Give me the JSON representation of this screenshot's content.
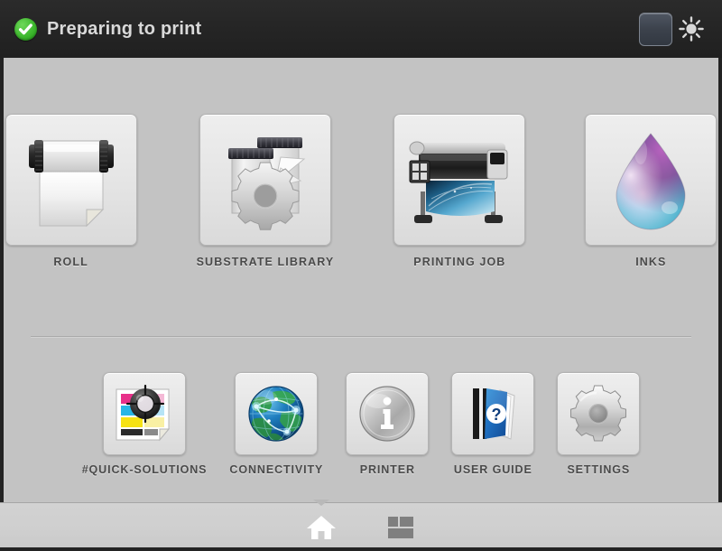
{
  "header": {
    "title": "Preparing to print",
    "status_icon": "check-circle-icon",
    "status_color": "#3eb82e",
    "controls": [
      {
        "name": "screen-dim-button",
        "icon": "screen-icon"
      },
      {
        "name": "brightness-button",
        "icon": "sun-icon"
      }
    ]
  },
  "main": {
    "primary_tiles": [
      {
        "label": "ROLL",
        "icon": "paper-roll-icon"
      },
      {
        "label": "SUBSTRATE LIBRARY",
        "icon": "substrate-gear-icon"
      },
      {
        "label": "PRINTING JOB",
        "icon": "large-format-printer-icon"
      },
      {
        "label": "INKS",
        "icon": "ink-droplet-icon"
      }
    ],
    "secondary_tiles": [
      {
        "label": "#QUICK-SOLUTIONS",
        "icon": "color-calibration-icon"
      },
      {
        "label": "CONNECTIVITY",
        "icon": "globe-network-icon"
      },
      {
        "label": "PRINTER",
        "icon": "info-disc-icon"
      },
      {
        "label": "USER GUIDE",
        "icon": "help-book-icon"
      },
      {
        "label": "SETTINGS",
        "icon": "gear-icon"
      }
    ]
  },
  "navigation": {
    "items": [
      {
        "name": "home",
        "icon": "home-icon",
        "active": true
      },
      {
        "name": "tiles",
        "icon": "grid-icon",
        "active": false
      }
    ]
  },
  "colors": {
    "header_bg": "#252525",
    "body_bg": "#c3c3c3",
    "tile_bg": "#e6e6e6",
    "label_text": "#4a4a4a",
    "bottom_bar": "#cfcfcf"
  }
}
